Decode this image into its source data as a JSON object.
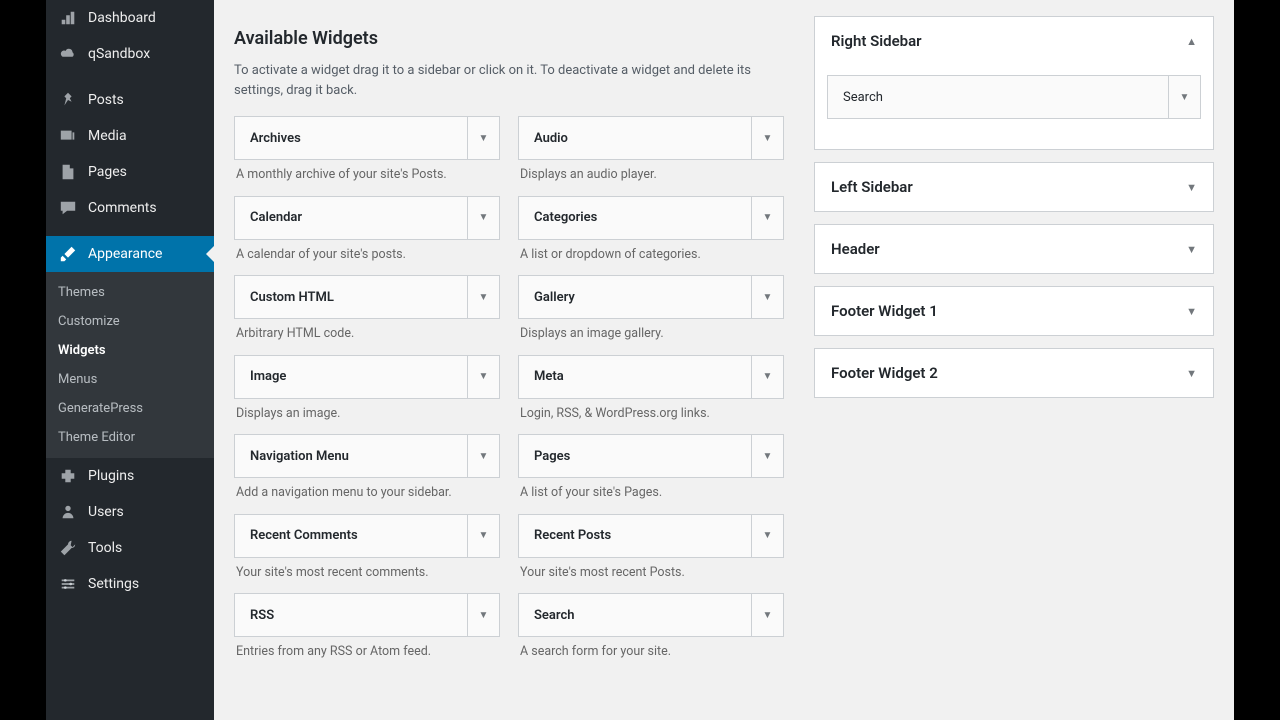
{
  "sidebar": {
    "items": [
      {
        "label": "Dashboard",
        "icon": "dashboard"
      },
      {
        "label": "qSandbox",
        "icon": "cloud"
      },
      {
        "label": "Posts",
        "icon": "pin"
      },
      {
        "label": "Media",
        "icon": "media"
      },
      {
        "label": "Pages",
        "icon": "page"
      },
      {
        "label": "Comments",
        "icon": "comment"
      },
      {
        "label": "Appearance",
        "icon": "brush",
        "active": true
      },
      {
        "label": "Plugins",
        "icon": "plugin"
      },
      {
        "label": "Users",
        "icon": "users"
      },
      {
        "label": "Tools",
        "icon": "tools"
      },
      {
        "label": "Settings",
        "icon": "settings"
      }
    ],
    "submenu": [
      {
        "label": "Themes"
      },
      {
        "label": "Customize"
      },
      {
        "label": "Widgets",
        "current": true
      },
      {
        "label": "Menus"
      },
      {
        "label": "GeneratePress"
      },
      {
        "label": "Theme Editor"
      }
    ]
  },
  "available": {
    "title": "Available Widgets",
    "description": "To activate a widget drag it to a sidebar or click on it. To deactivate a widget and delete its settings, drag it back.",
    "widgets": [
      {
        "name": "Archives",
        "desc": "A monthly archive of your site's Posts."
      },
      {
        "name": "Audio",
        "desc": "Displays an audio player."
      },
      {
        "name": "Calendar",
        "desc": "A calendar of your site's posts."
      },
      {
        "name": "Categories",
        "desc": "A list or dropdown of categories."
      },
      {
        "name": "Custom HTML",
        "desc": "Arbitrary HTML code."
      },
      {
        "name": "Gallery",
        "desc": "Displays an image gallery."
      },
      {
        "name": "Image",
        "desc": "Displays an image."
      },
      {
        "name": "Meta",
        "desc": "Login, RSS, & WordPress.org links."
      },
      {
        "name": "Navigation Menu",
        "desc": "Add a navigation menu to your sidebar."
      },
      {
        "name": "Pages",
        "desc": "A list of your site's Pages."
      },
      {
        "name": "Recent Comments",
        "desc": "Your site's most recent comments."
      },
      {
        "name": "Recent Posts",
        "desc": "Your site's most recent Posts."
      },
      {
        "name": "RSS",
        "desc": "Entries from any RSS or Atom feed."
      },
      {
        "name": "Search",
        "desc": "A search form for your site."
      }
    ]
  },
  "areas": [
    {
      "title": "Right Sidebar",
      "open": true,
      "widgets": [
        {
          "name": "Search"
        }
      ]
    },
    {
      "title": "Left Sidebar",
      "open": false
    },
    {
      "title": "Header",
      "open": false
    },
    {
      "title": "Footer Widget 1",
      "open": false
    },
    {
      "title": "Footer Widget 2",
      "open": false
    }
  ]
}
